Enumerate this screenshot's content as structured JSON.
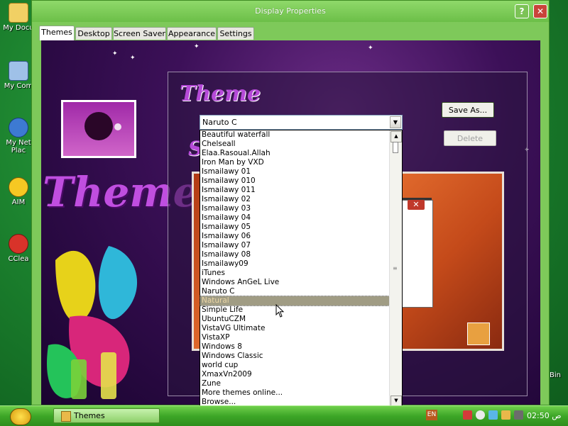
{
  "window": {
    "title": "Display Properties",
    "help_label": "?",
    "close_label": "✕"
  },
  "tabs": [
    {
      "label": "Themes",
      "active": true
    },
    {
      "label": "Desktop"
    },
    {
      "label": "Screen Saver"
    },
    {
      "label": "Appearance"
    },
    {
      "label": "Settings"
    }
  ],
  "decor": {
    "themes_word": "Themes",
    "theme_label": "Theme",
    "s_letter": "S"
  },
  "buttons": {
    "save_as": "Save As...",
    "delete": "Delete"
  },
  "theme_combo": {
    "value": "Naruto C",
    "options": [
      "Beautiful waterfall",
      "Chelseall",
      "Elaa.Rasoual.Allah",
      "Iron Man by VXD",
      "Ismailawy 01",
      "Ismailawy 010",
      "Ismailawy 011",
      "Ismailawy 02",
      "Ismailawy 03",
      "Ismailawy 04",
      "Ismailawy 05",
      "Ismailawy 06",
      "Ismailawy 07",
      "Ismailawy 08",
      "Ismailawy09",
      "iTunes",
      "Windows AnGeL Live",
      "Naruto C",
      "Natural",
      "Simple Life",
      "UbuntuCZM",
      "VistaVG Ultimate",
      "VistaXP",
      "Windows 8",
      "Windows Classic",
      "world cup",
      "XmaxVn2009",
      "Zune",
      "More themes online...",
      "Browse..."
    ],
    "highlighted": "Natural"
  },
  "preview": {
    "close_label": "✕"
  },
  "desktop_icons": [
    {
      "label": "My Docu"
    },
    {
      "label": "My Com"
    },
    {
      "label": "My Net"
    },
    {
      "label": "Plac"
    },
    {
      "label": "AIM"
    },
    {
      "label": "CClea"
    }
  ],
  "recycle_bin": {
    "label": "Bin"
  },
  "taskbar": {
    "task_label": "Themes",
    "language": "EN",
    "clock": "02:50 ص"
  },
  "colors": {
    "window_green": "#7ec95a",
    "taskbar_green": "#3da627",
    "accent_purple": "#b64ad9",
    "selection": "#a09c84"
  }
}
